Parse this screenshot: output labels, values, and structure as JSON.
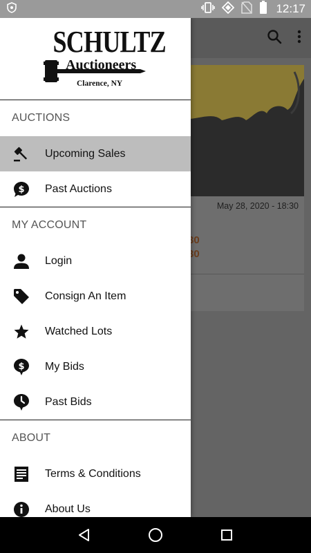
{
  "status_bar": {
    "time": "12:17"
  },
  "logo": {
    "main": "SCHULTZ",
    "sub": "Auctioneers",
    "location": "Clarence, NY"
  },
  "drawer": {
    "sections": [
      {
        "header": "AUCTIONS",
        "items": [
          {
            "label": "Upcoming Sales",
            "icon": "gavel-icon",
            "active": true
          },
          {
            "label": "Past Auctions",
            "icon": "dollar-bubble-icon",
            "active": false
          }
        ]
      },
      {
        "header": "MY ACCOUNT",
        "items": [
          {
            "label": "Login",
            "icon": "person-icon"
          },
          {
            "label": "Consign An Item",
            "icon": "tag-icon"
          },
          {
            "label": "Watched Lots",
            "icon": "star-icon"
          },
          {
            "label": "My Bids",
            "icon": "dollar-pin-icon"
          },
          {
            "label": "Past Bids",
            "icon": "clock-pin-icon"
          }
        ]
      },
      {
        "header": "ABOUT",
        "items": [
          {
            "label": "Terms & Conditions",
            "icon": "document-icon"
          },
          {
            "label": "About Us",
            "icon": "info-icon"
          }
        ]
      }
    ]
  },
  "background": {
    "card_date": "May 28, 2020 - 18:30",
    "price_1": "30",
    "price_2": "30"
  },
  "colors": {
    "drawer_bg": "#ffffff",
    "active_item_bg": "#bdbdbd",
    "status_bar": "#9a9a9a",
    "nav_bar": "#000000"
  }
}
